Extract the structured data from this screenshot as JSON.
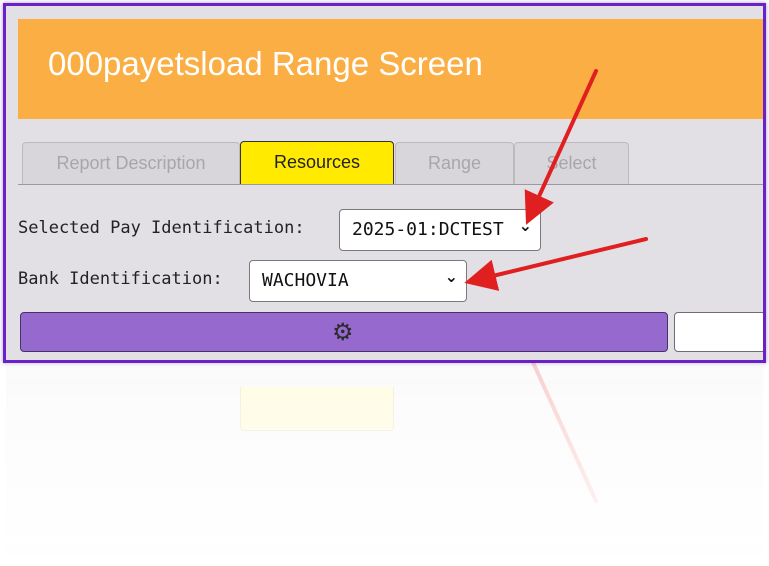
{
  "window": {
    "title": "000payetsload Range Screen"
  },
  "tabs": [
    {
      "label": "Report Description",
      "active": false
    },
    {
      "label": "Resources",
      "active": true
    },
    {
      "label": "Range",
      "active": false
    },
    {
      "label": "Select",
      "active": false
    }
  ],
  "form": {
    "pay_id_label": "Selected Pay Identification:",
    "pay_id_value": "2025-01:DCTEST",
    "bank_id_label": "Bank Identification:",
    "bank_id_value": "WACHOVIA"
  },
  "toolbar": {
    "run_icon": "gear-icon"
  },
  "colors": {
    "title_bar": "#fbae43",
    "active_tab": "#ffea00",
    "run_button": "#9669cf",
    "frame": "#6a22c8",
    "annotation_arrow": "#e02020"
  }
}
